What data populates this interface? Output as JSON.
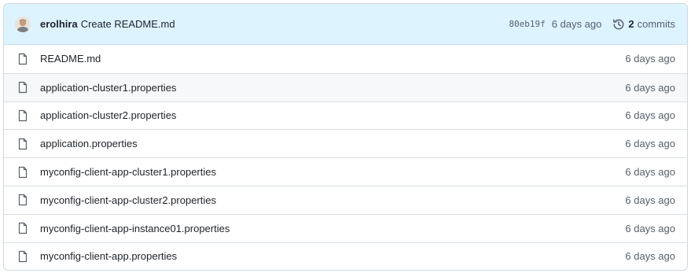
{
  "latest_commit": {
    "author": "erolhira",
    "message": "Create README.md",
    "sha": "80eb19f",
    "age": "6 days ago",
    "commits_count": "2",
    "commits_word": "commits"
  },
  "files": [
    {
      "name": "README.md",
      "age": "6 days ago"
    },
    {
      "name": "application-cluster1.properties",
      "age": "6 days ago"
    },
    {
      "name": "application-cluster2.properties",
      "age": "6 days ago"
    },
    {
      "name": "application.properties",
      "age": "6 days ago"
    },
    {
      "name": "myconfig-client-app-cluster1.properties",
      "age": "6 days ago"
    },
    {
      "name": "myconfig-client-app-cluster2.properties",
      "age": "6 days ago"
    },
    {
      "name": "myconfig-client-app-instance01.properties",
      "age": "6 days ago"
    },
    {
      "name": "myconfig-client-app.properties",
      "age": "6 days ago"
    }
  ],
  "colors": {
    "header_bg": "#ddf4ff",
    "row_hover_bg": "#f6f8fa",
    "muted_text": "#57606a"
  },
  "icons": {
    "file": "file-icon",
    "history": "history-icon",
    "avatar": "avatar"
  }
}
